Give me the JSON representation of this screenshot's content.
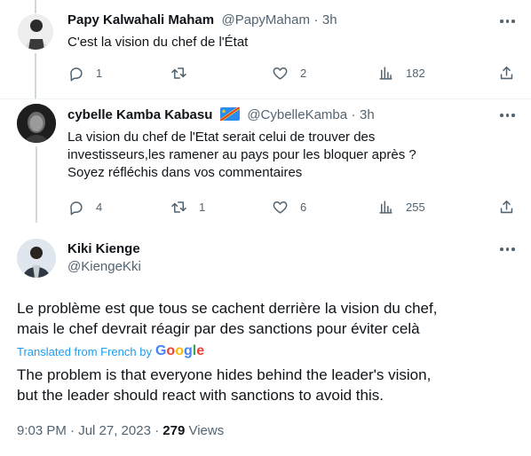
{
  "replies": [
    {
      "display_name": "Papy Kalwahali Maham",
      "handle": "@PapyMaham",
      "separator": "·",
      "time": "3h",
      "text": "C'est la vision du chef de l'État",
      "actions": {
        "replies": "1",
        "retweets": "",
        "likes": "2",
        "views": "182"
      }
    },
    {
      "display_name": "cybelle Kamba Kabasu",
      "flag_icon": "drc-flag-icon",
      "handle": "@CybelleKamba",
      "separator": "·",
      "time": "3h",
      "text_lines": [
        "La vision du chef de l'Etat serait celui de trouver des",
        "investisseurs,les ramener au pays pour les bloquer après ?",
        "Soyez réfléchis dans vos commentaires"
      ],
      "actions": {
        "replies": "4",
        "retweets": "1",
        "likes": "6",
        "views": "255"
      }
    }
  ],
  "main_tweet": {
    "display_name": "Kiki Kienge",
    "handle": "@KiengeKki",
    "text_lines": [
      "Le problème est que tous se cachent derrière la vision du chef,",
      "mais le chef devrait réagir par des sanctions pour éviter celà"
    ],
    "translated_from": "Translated from French by",
    "translator_brand": "Google",
    "translation_lines": [
      "The problem is that everyone hides behind the leader's vision,",
      "but the leader should react with sanctions to avoid this."
    ],
    "timestamp": "9:03 PM · Jul 27, 2023 · ",
    "views_count": "279",
    "views_label": " Views"
  },
  "colors": {
    "text": "#0f1419",
    "muted": "#536471",
    "link": "#1d9bf0",
    "divider": "#eff3f4",
    "thread_line": "#cfd9de"
  }
}
